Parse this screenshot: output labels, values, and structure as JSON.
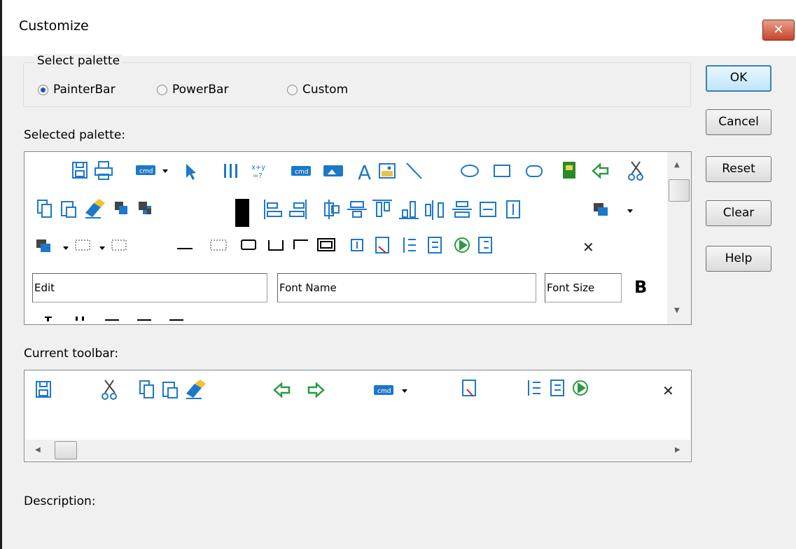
{
  "window": {
    "title": "Customize",
    "close_glyph": "✕"
  },
  "select_palette": {
    "label": "Select palette",
    "options": [
      {
        "label": "PainterBar",
        "selected": true
      },
      {
        "label": "PowerBar",
        "selected": false
      },
      {
        "label": "Custom",
        "selected": false
      }
    ]
  },
  "selected_palette_label": "Selected palette:",
  "palette_fields": {
    "edit": "Edit",
    "font_name": "Font Name",
    "font_size": "Font Size",
    "bold": "B"
  },
  "current_toolbar_label": "Current toolbar:",
  "description_label": "Description:",
  "buttons": {
    "ok": "OK",
    "cancel": "Cancel",
    "reset": "Reset",
    "clear": "Clear",
    "help": "Help"
  },
  "colors": {
    "icon_blue": "#1e78c8",
    "icon_green": "#3aaa35",
    "dialog_bg": "#f0f0f0",
    "close_red": "#c7432a"
  }
}
